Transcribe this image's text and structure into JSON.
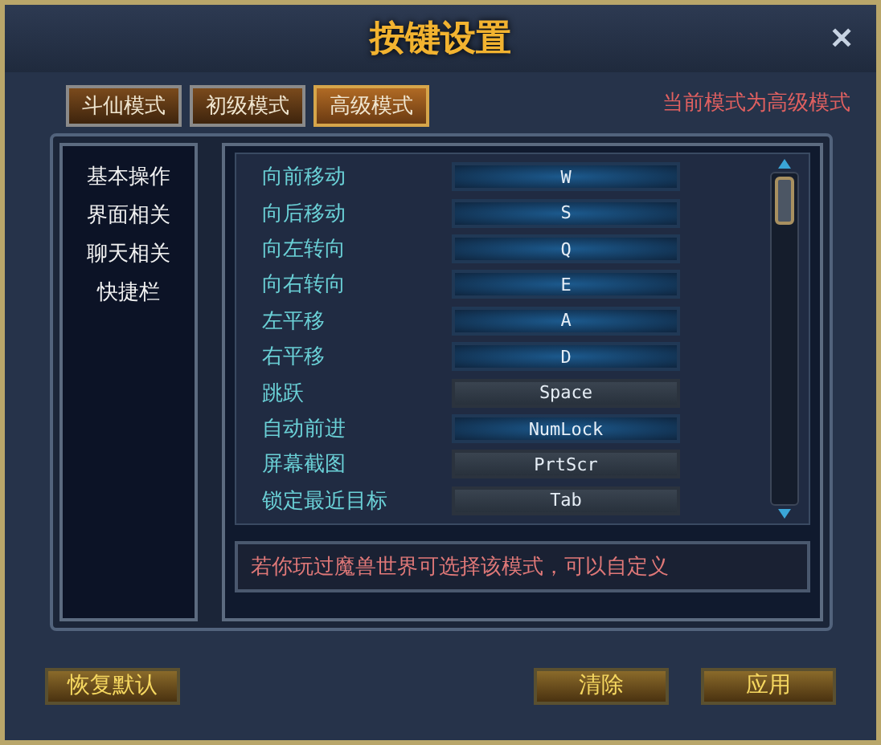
{
  "window": {
    "title": "按键设置",
    "close": "✕"
  },
  "tabs": [
    {
      "label": "斗仙模式",
      "selected": false
    },
    {
      "label": "初级模式",
      "selected": false
    },
    {
      "label": "高级模式",
      "selected": true
    }
  ],
  "mode_status": "当前模式为高级模式",
  "sidebar": {
    "items": [
      {
        "label": "基本操作"
      },
      {
        "label": "界面相关"
      },
      {
        "label": "聊天相关"
      },
      {
        "label": "快捷栏"
      }
    ]
  },
  "bindings": [
    {
      "action": "向前移动",
      "key": "W",
      "disabled": false
    },
    {
      "action": "向后移动",
      "key": "S",
      "disabled": false
    },
    {
      "action": "向左转向",
      "key": "Q",
      "disabled": false
    },
    {
      "action": "向右转向",
      "key": "E",
      "disabled": false
    },
    {
      "action": "左平移",
      "key": "A",
      "disabled": false
    },
    {
      "action": "右平移",
      "key": "D",
      "disabled": false
    },
    {
      "action": "跳跃",
      "key": "Space",
      "disabled": true
    },
    {
      "action": "自动前进",
      "key": "NumLock",
      "disabled": false
    },
    {
      "action": "屏幕截图",
      "key": "PrtScr",
      "disabled": true
    },
    {
      "action": "锁定最近目标",
      "key": "Tab",
      "disabled": true
    }
  ],
  "hint": "若你玩过魔兽世界可选择该模式，可以自定义",
  "buttons": [
    {
      "label": "恢复默认",
      "kind": "reset"
    },
    {
      "label": "清除",
      "kind": "clear"
    },
    {
      "label": "应用",
      "kind": "apply"
    }
  ]
}
